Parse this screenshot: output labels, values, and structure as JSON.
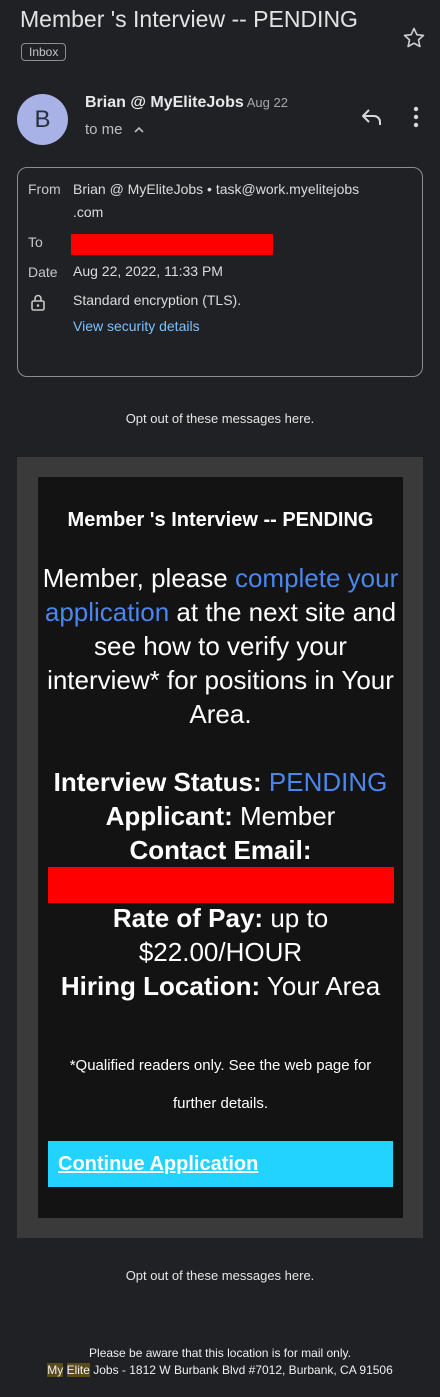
{
  "header": {
    "subject": "Member 's Interview -- PENDING",
    "label_chip": "Inbox"
  },
  "sender": {
    "avatar_letter": "B",
    "name": "Brian @ MyEliteJobs",
    "date": "Aug 22",
    "to_me": "to me"
  },
  "details": {
    "from_label": "From",
    "from_value": "Brian @ MyEliteJobs • task@work.myelitejobs",
    "from_value_cont": ".com",
    "to_label": "To",
    "date_label": "Date",
    "date_value": "Aug 22, 2022, 11:33 PM",
    "encryption": "Standard encryption (TLS).",
    "security_link": "View security details"
  },
  "optout_text": "Opt out of these messages here.",
  "body": {
    "title": "Member 's Interview -- PENDING",
    "para_1": "Member, please ",
    "para_link": "complete your application",
    "para_2": " at the next site and see how to verify your interview* for positions in Your Area.",
    "status_label": "Interview Status:",
    "status_value": "PENDING",
    "applicant_label": "Applicant:",
    "applicant_value": "Member",
    "email_label": "Contact Email:",
    "pay_label": "Rate of Pay:",
    "pay_value_1": "up to",
    "pay_value_2": "$22.00/HOUR",
    "location_label": "Hiring Location:",
    "location_value": "Your Area",
    "note_1": "*Qualified readers only. See the web page for",
    "note_2": "further details.",
    "cta": "Continue Application"
  },
  "footer": {
    "line_1": "Please be aware that this location is for mail only.",
    "brand_1": "My",
    "brand_2": "Elite",
    "address": " Jobs - 1812 W Burbank Blvd #7012, Burbank, CA 91506"
  },
  "colors": {
    "background": "#1f2125",
    "link_blue": "#4a86ee",
    "cta": "#23d3ff",
    "redaction": "#ff0000"
  },
  "icons": [
    "star-icon",
    "reply-icon",
    "more-vert-icon",
    "chevron-up-icon",
    "lock-icon"
  ]
}
